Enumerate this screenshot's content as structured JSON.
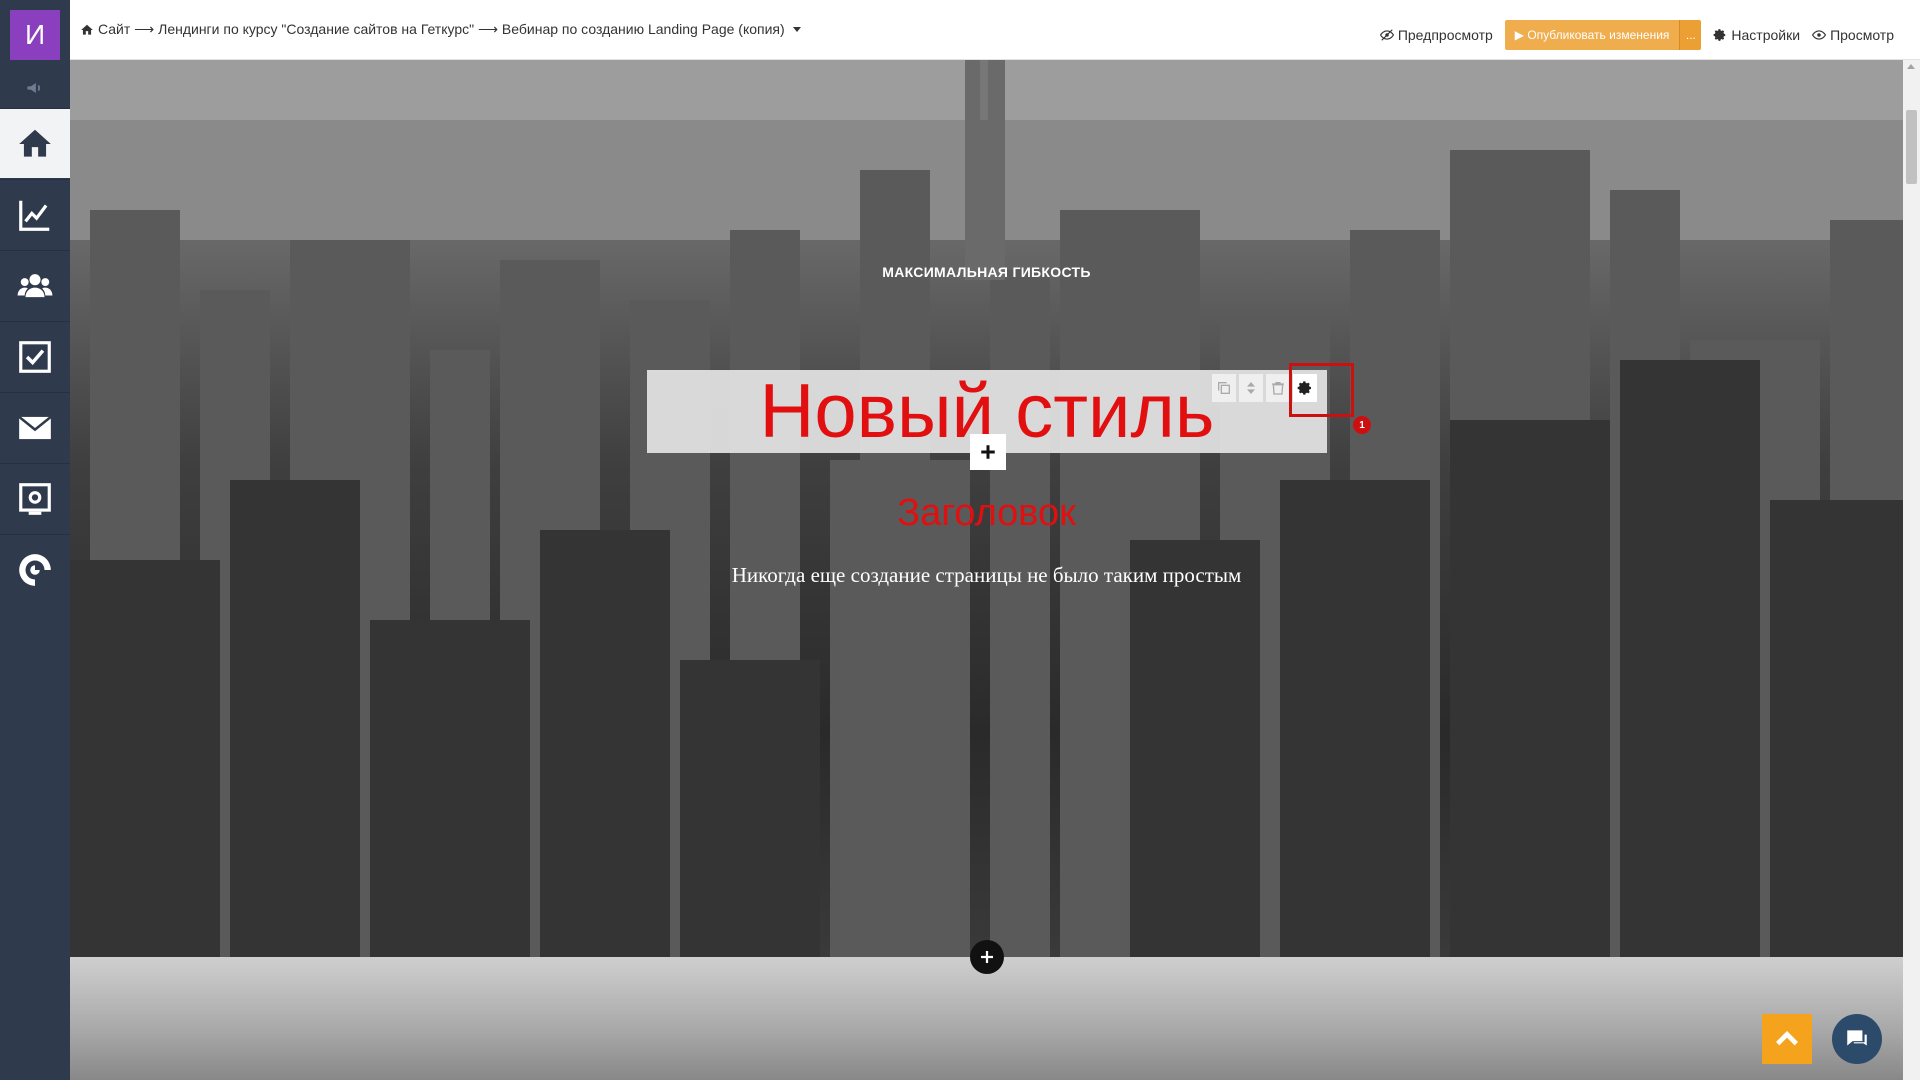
{
  "user": {
    "avatar_letter": "И"
  },
  "colors": {
    "sidebar_bg": "#2f3b4c",
    "avatar_bg": "#8a3fbf",
    "publish": "#f0ad4e",
    "title_red": "#e10f0f",
    "highlight": "#cc1010",
    "to_top": "#f5a31c",
    "chat": "#2c4a6a"
  },
  "sidebar": {
    "items": [
      {
        "name": "home",
        "icon": "home-icon",
        "active": true
      },
      {
        "name": "analytics",
        "icon": "chart-icon",
        "active": false
      },
      {
        "name": "users",
        "icon": "users-icon",
        "active": false
      },
      {
        "name": "tasks",
        "icon": "checkbox-icon",
        "active": false
      },
      {
        "name": "messages",
        "icon": "envelope-icon",
        "active": false
      },
      {
        "name": "settings",
        "icon": "monitor-gear-icon",
        "active": false
      },
      {
        "name": "getcourse",
        "icon": "getcourse-logo-icon",
        "active": false
      }
    ]
  },
  "breadcrumb": {
    "text": "Сайт ⟶ Лендинги по курсу \"Создание сайтов на Геткурс\" ⟶ Вебинар по созданию Landing Page (копия)"
  },
  "toolbar": {
    "preview": "Предпросмотр",
    "publish": "▶ Опубликовать изменения",
    "publish_more": "...",
    "settings": "Настройки",
    "view": "Просмотр"
  },
  "hero": {
    "kicker": "МАКСИМАЛЬНАЯ ГИБКОСТЬ",
    "title": "Новый стиль",
    "heading": "Заголовок",
    "subtitle": "Никогда еще создание страницы не было таким простым"
  },
  "annotation": {
    "badge": "1"
  }
}
